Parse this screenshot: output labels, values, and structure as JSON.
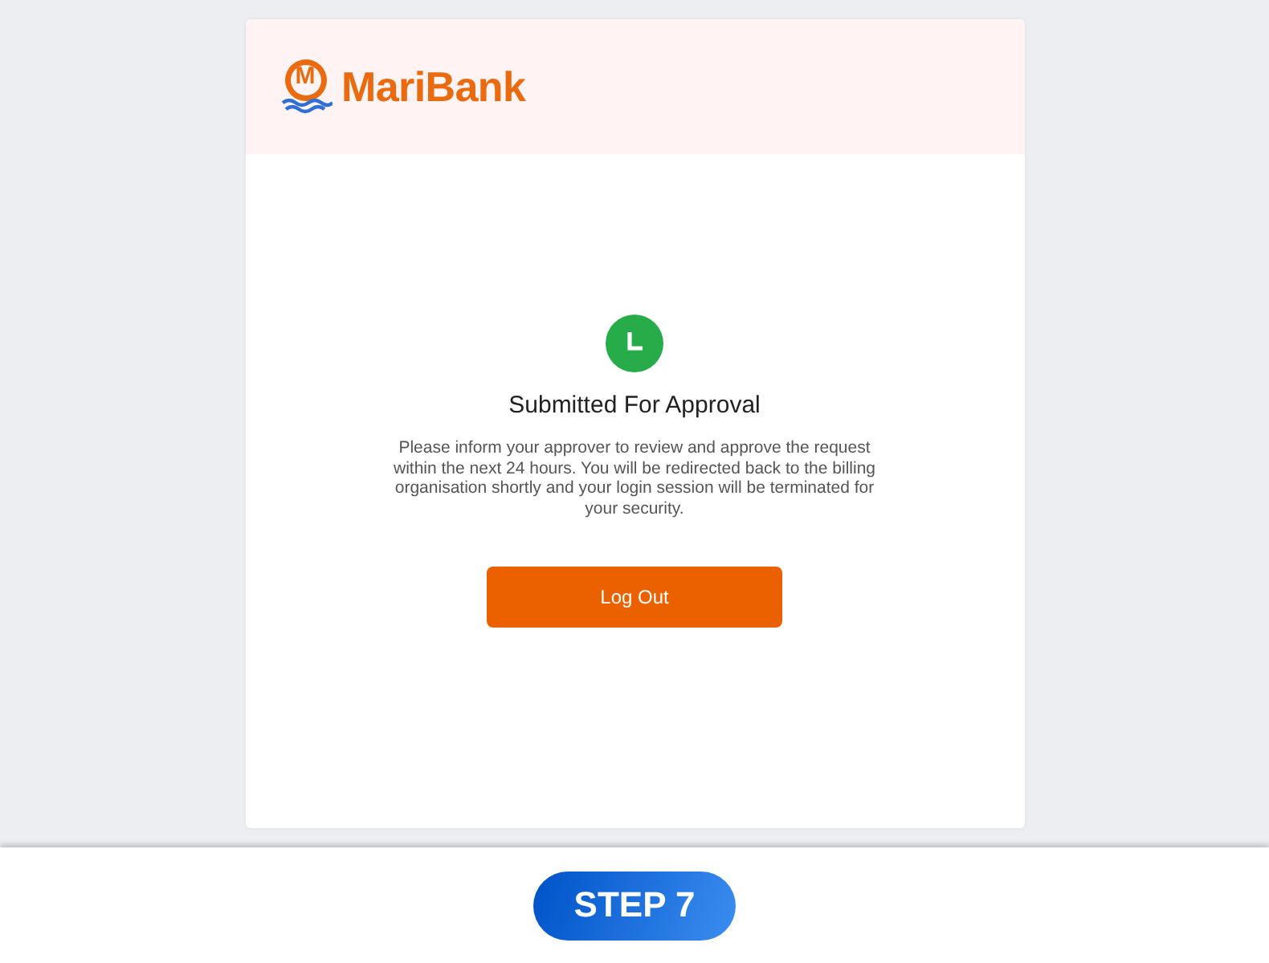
{
  "header": {
    "logo_mark": "M",
    "logo_text": "MariBank"
  },
  "status": {
    "title": "Submitted For Approval",
    "message": "Please inform your approver to review and approve the request within the next 24 hours. You will be redirected back to the billing organisation shortly and your login session will be terminated for your security."
  },
  "buttons": [
    "Log Out"
  ],
  "footer": {
    "step": "STEP 7"
  }
}
